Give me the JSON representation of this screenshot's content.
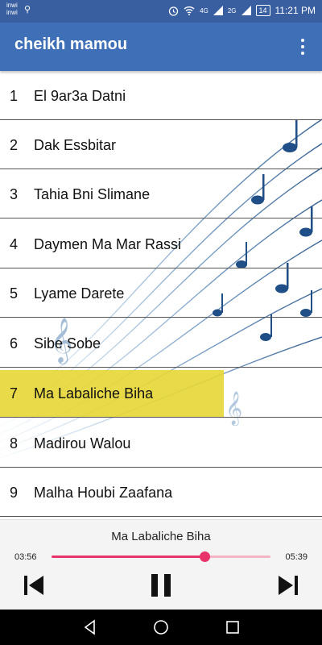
{
  "status_bar": {
    "carrier_1": "inwi",
    "carrier_2": "inwi",
    "network": "4G",
    "network_2": "2G",
    "battery": "14",
    "time": "11:21 PM"
  },
  "app_bar": {
    "title": "cheikh mamou"
  },
  "songs": [
    {
      "num": "1",
      "title": "El 9ar3a Datni"
    },
    {
      "num": "2",
      "title": "Dak Essbitar"
    },
    {
      "num": "3",
      "title": "Tahia Bni Slimane"
    },
    {
      "num": "4",
      "title": "Daymen Ma Mar Rassi"
    },
    {
      "num": "5",
      "title": " Lyame Darete"
    },
    {
      "num": "6",
      "title": "Sibe Sobe"
    },
    {
      "num": "7",
      "title": "Ma Labaliche Biha"
    },
    {
      "num": "8",
      "title": "Madirou Walou"
    },
    {
      "num": "9",
      "title": "Malha Houbi Zaafana"
    }
  ],
  "selected_index": 6,
  "player": {
    "now_playing": "Ma Labaliche Biha",
    "current_time": "03:56",
    "total_time": "05:39",
    "progress": 0.7,
    "accent_color": "#e8346a"
  },
  "icons": {
    "menu": "overflow-menu-icon",
    "prev": "skip-previous-icon",
    "pause": "pause-icon",
    "next": "skip-next-icon",
    "back": "nav-back-icon",
    "home": "nav-home-icon",
    "recents": "nav-recents-icon"
  }
}
